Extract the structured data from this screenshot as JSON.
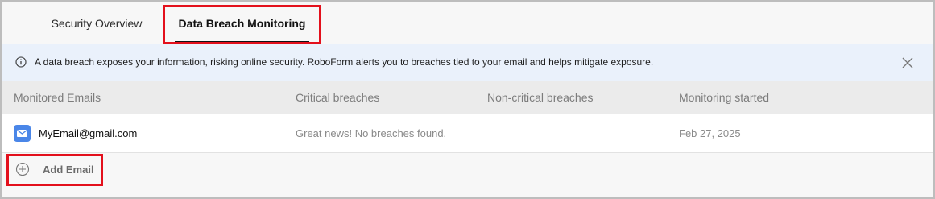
{
  "tabs": [
    {
      "label": "Security Overview",
      "active": false
    },
    {
      "label": "Data Breach Monitoring",
      "active": true
    }
  ],
  "banner": {
    "icon": "info-icon",
    "text": "A data breach exposes your information, risking online security. RoboForm alerts you to breaches tied to your email and helps mitigate exposure.",
    "close_icon": "close-icon"
  },
  "table": {
    "columns": [
      "Monitored Emails",
      "Critical breaches",
      "Non-critical breaches",
      "Monitoring started"
    ],
    "rows": [
      {
        "icon": "mail-icon",
        "email": "MyEmail@gmail.com",
        "critical": "Great news! No breaches found.",
        "non_critical": "",
        "started": "Feb 27, 2025"
      }
    ]
  },
  "add_email": {
    "icon": "plus-circle-icon",
    "label": "Add Email"
  },
  "colors": {
    "accent": "#e3101c",
    "banner_bg": "#eaf1fb",
    "mail_icon": "#4a86e8"
  }
}
